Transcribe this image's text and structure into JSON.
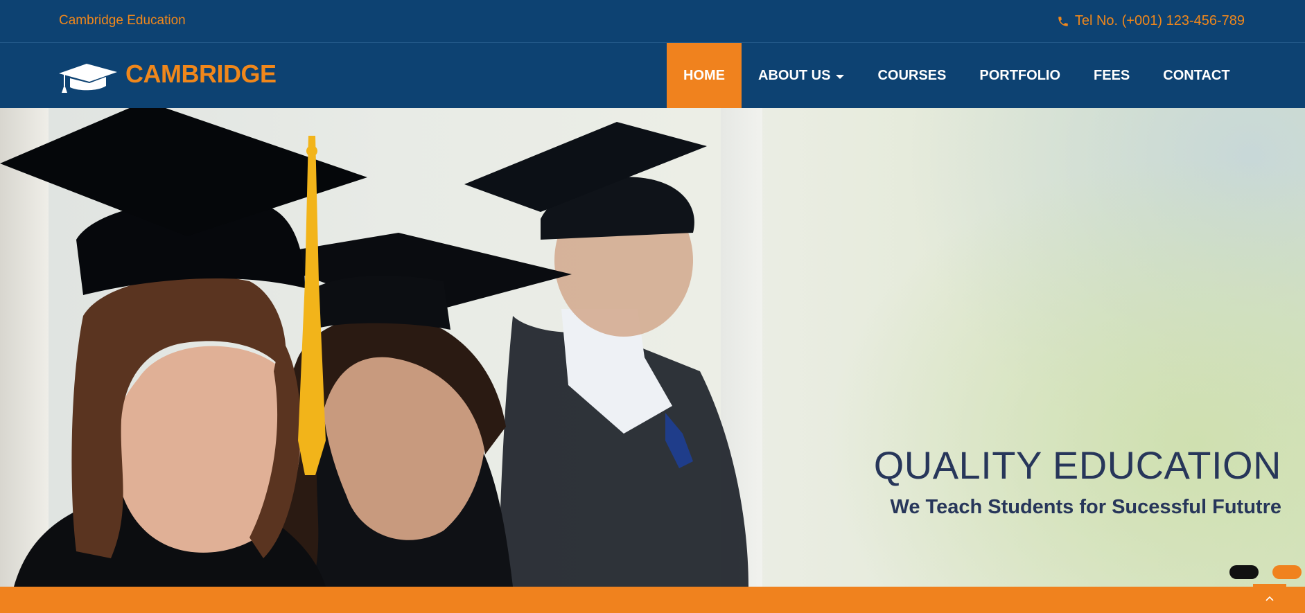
{
  "topbar": {
    "site_name": "Cambridge Education",
    "phone": "Tel No. (+001) 123-456-789",
    "phone_icon": "phone-icon"
  },
  "brand": {
    "logo_text": "CAMBRIDGE",
    "logo_icon": "graduation-cap-icon"
  },
  "nav": {
    "items": [
      {
        "label": "HOME",
        "active": true
      },
      {
        "label": "ABOUT US",
        "has_dropdown": true
      },
      {
        "label": "COURSES"
      },
      {
        "label": "PORTFOLIO"
      },
      {
        "label": "FEES"
      },
      {
        "label": "CONTACT"
      }
    ]
  },
  "hero": {
    "headline": "QUALITY EDUCATION",
    "subline": "We Teach Students for Sucessful Fututre",
    "slides": 2,
    "active_slide": 1
  },
  "footer": {
    "back_to_top_icon": "chevron-up-icon"
  },
  "colors": {
    "primary": "#0d4272",
    "accent": "#f0821e",
    "headline": "#27365a"
  }
}
